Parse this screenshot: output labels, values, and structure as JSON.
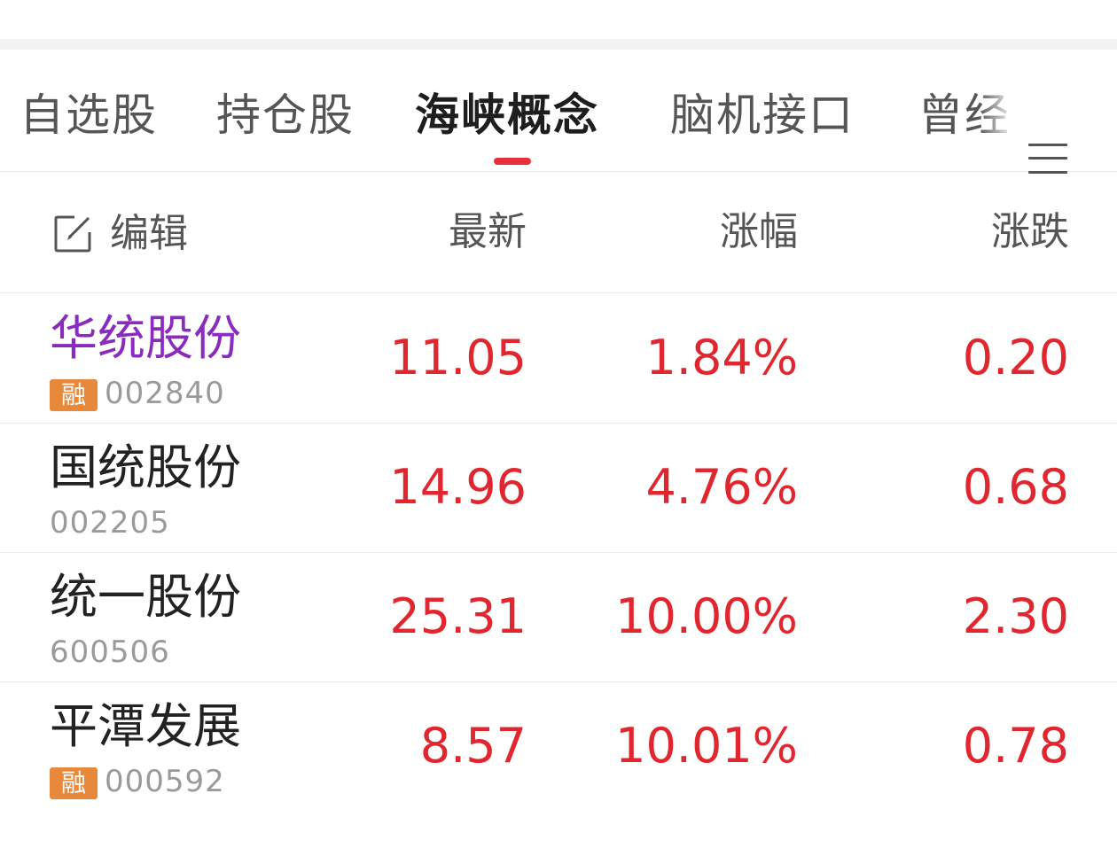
{
  "tabs": [
    {
      "label": "自选股",
      "active": false
    },
    {
      "label": "持仓股",
      "active": false
    },
    {
      "label": "海峡概念",
      "active": true
    },
    {
      "label": "脑机接口",
      "active": false
    },
    {
      "label": "曾经",
      "active": false
    }
  ],
  "header": {
    "edit_label": "编辑",
    "col_price": "最新",
    "col_pct": "涨幅",
    "col_change": "涨跌"
  },
  "stocks": [
    {
      "name": "华统股份",
      "code": "002840",
      "badge": "融",
      "price": "11.05",
      "pct": "1.84%",
      "change": "0.20"
    },
    {
      "name": "国统股份",
      "code": "002205",
      "badge": "",
      "price": "14.96",
      "pct": "4.76%",
      "change": "0.68"
    },
    {
      "name": "统一股份",
      "code": "600506",
      "badge": "",
      "price": "25.31",
      "pct": "10.00%",
      "change": "2.30"
    },
    {
      "name": "平潭发展",
      "code": "000592",
      "badge": "融",
      "price": "8.57",
      "pct": "10.01%",
      "change": "0.78"
    }
  ],
  "colors": {
    "up": "#e0262e",
    "accent": "#e8303c",
    "highlight_name": "#8a2bbf",
    "badge_bg": "#e8883a"
  },
  "icons": {
    "edit": "edit-icon",
    "menu": "menu-icon"
  }
}
